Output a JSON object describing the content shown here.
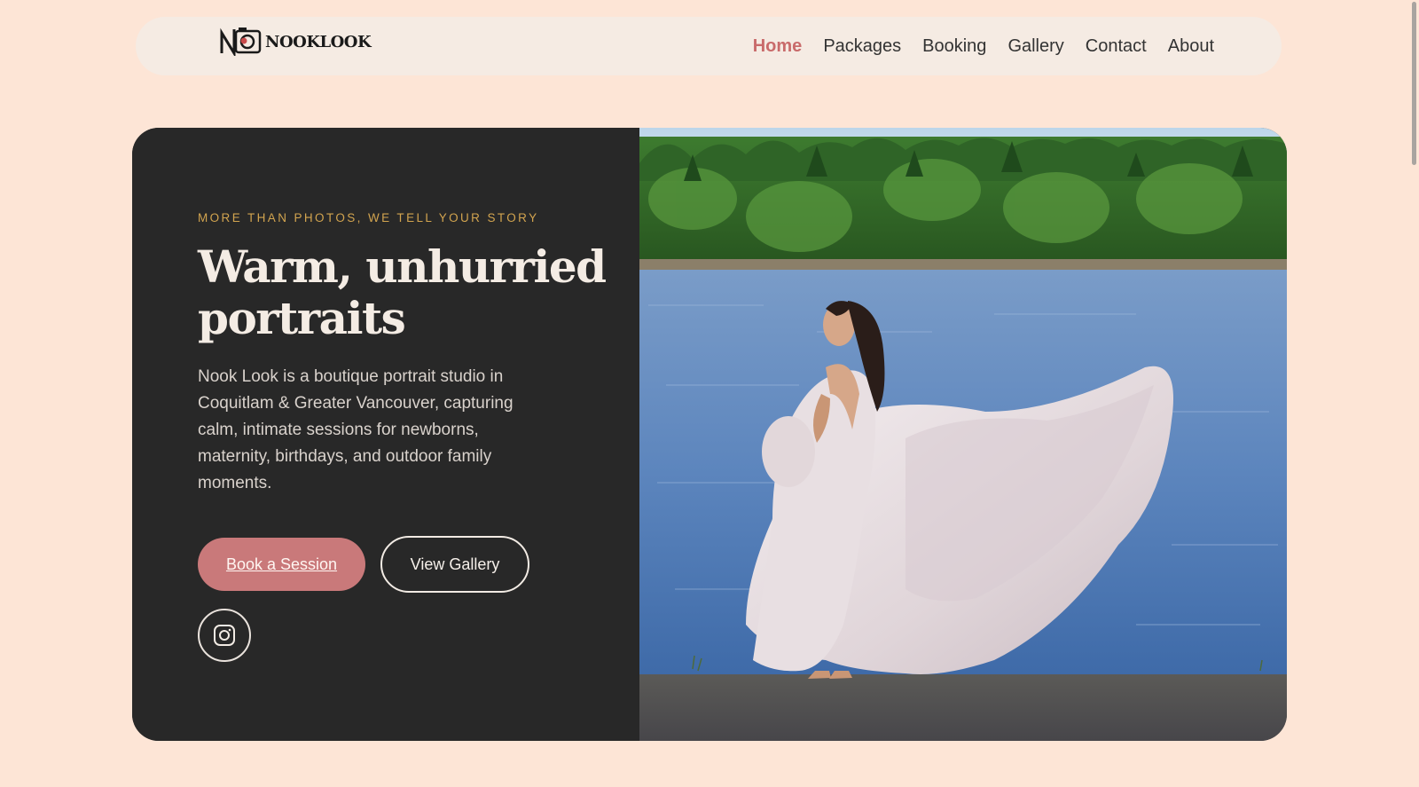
{
  "brand": {
    "name": "NOOKLOOK"
  },
  "nav": {
    "items": [
      {
        "label": "Home",
        "active": true
      },
      {
        "label": "Packages",
        "active": false
      },
      {
        "label": "Booking",
        "active": false
      },
      {
        "label": "Gallery",
        "active": false
      },
      {
        "label": "Contact",
        "active": false
      },
      {
        "label": "About",
        "active": false
      }
    ]
  },
  "hero": {
    "eyebrow": "MORE THAN PHOTOS, WE TELL YOUR STORY",
    "headline": "Warm, unhurried portraits",
    "description": "Nook Look is a boutique portrait studio in Coquitlam & Greater Vancouver, capturing calm, intimate sessions for newborns, maternity, birthdays, and outdoor family moments.",
    "primary_cta": "Book a Session",
    "secondary_cta": "View Gallery",
    "social_icon": "instagram-icon"
  },
  "colors": {
    "page_bg": "#fde5d6",
    "nav_bg": "#f5ebe3",
    "accent": "#c96b6b",
    "panel_dark": "#282828",
    "eyebrow": "#d2a44f",
    "button_primary": "#c9797a"
  }
}
